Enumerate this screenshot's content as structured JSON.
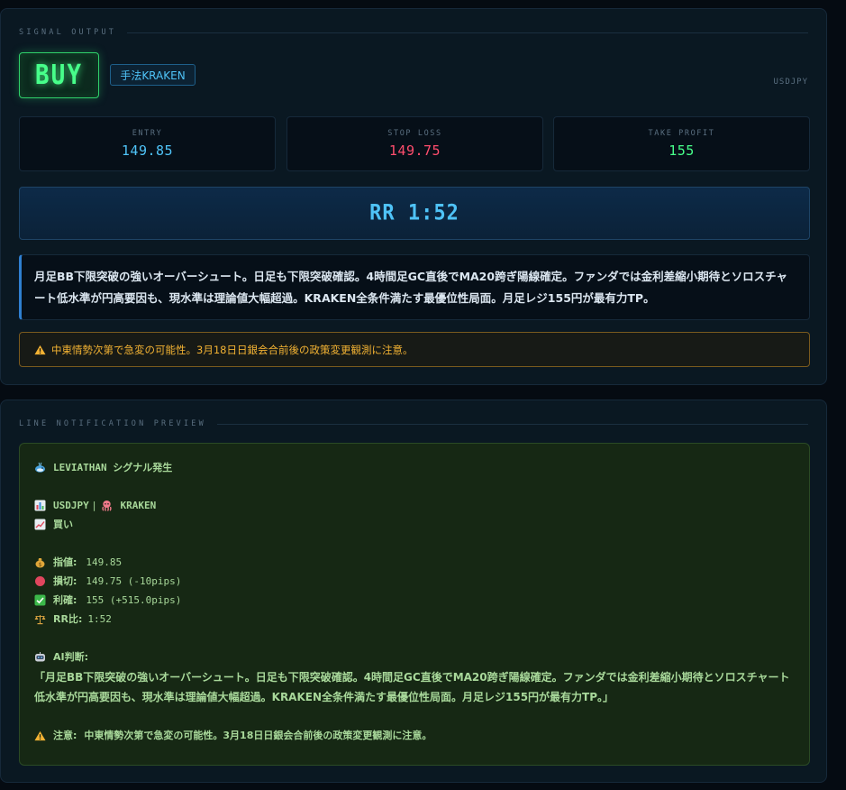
{
  "signal": {
    "section_title": "SIGNAL OUTPUT",
    "direction": "BUY",
    "method_tag": "手法KRAKEN",
    "pair": "USDJPY",
    "entry": {
      "label": "ENTRY",
      "value": "149.85"
    },
    "stop_loss": {
      "label": "STOP LOSS",
      "value": "149.75"
    },
    "take_profit": {
      "label": "TAKE PROFIT",
      "value": "155"
    },
    "rr": "RR 1:52",
    "analysis": "月足BB下限突破の強いオーバーシュート。日足も下限突破確認。4時間足GC直後でMA20跨ぎ陽線確定。ファンダでは金利差縮小期待とソロスチャート低水準が円高要因も、現水準は理論値大幅超過。KRAKEN全条件満たす最優位性局面。月足レジ155円が最有力TP。",
    "warning": "中東情勢次第で急変の可能性。3月18日日銀会合前後の政策変更観測に注意。"
  },
  "line_preview": {
    "section_title": "LINE NOTIFICATION PREVIEW",
    "header": "LEVIATHAN シグナル発生",
    "pair": "USDJPY",
    "separator": "|",
    "method": "KRAKEN",
    "direction": "買い",
    "entry_label": "指値:",
    "entry_value": "149.85",
    "sl_label": "損切:",
    "sl_value": "149.75 (-10pips)",
    "tp_label": "利確:",
    "tp_value": "155 (+515.0pips)",
    "rr_label": "RR比:",
    "rr_value": "1:52",
    "ai_label": "AI判断:",
    "ai_quote": "「月足BB下限突破の強いオーバーシュート。日足も下限突破確認。4時間足GC直後でMA20跨ぎ陽線確定。ファンダでは金利差縮小期待とソロスチャート低水準が円高要因も、現水準は理論値大幅超過。KRAKEN全条件満たす最優位性局面。月足レジ155円が最有力TP。」",
    "warning_label": "注意:",
    "warning_text": "中東情勢次第で急変の可能性。3月18日日銀会合前後の政策変更観測に注意。"
  },
  "colors": {
    "buy": "#47ff8a",
    "entry": "#4fc3f7",
    "stop_loss": "#ff4d6d",
    "take_profit": "#47ff8a",
    "warning": "#f2b233"
  }
}
